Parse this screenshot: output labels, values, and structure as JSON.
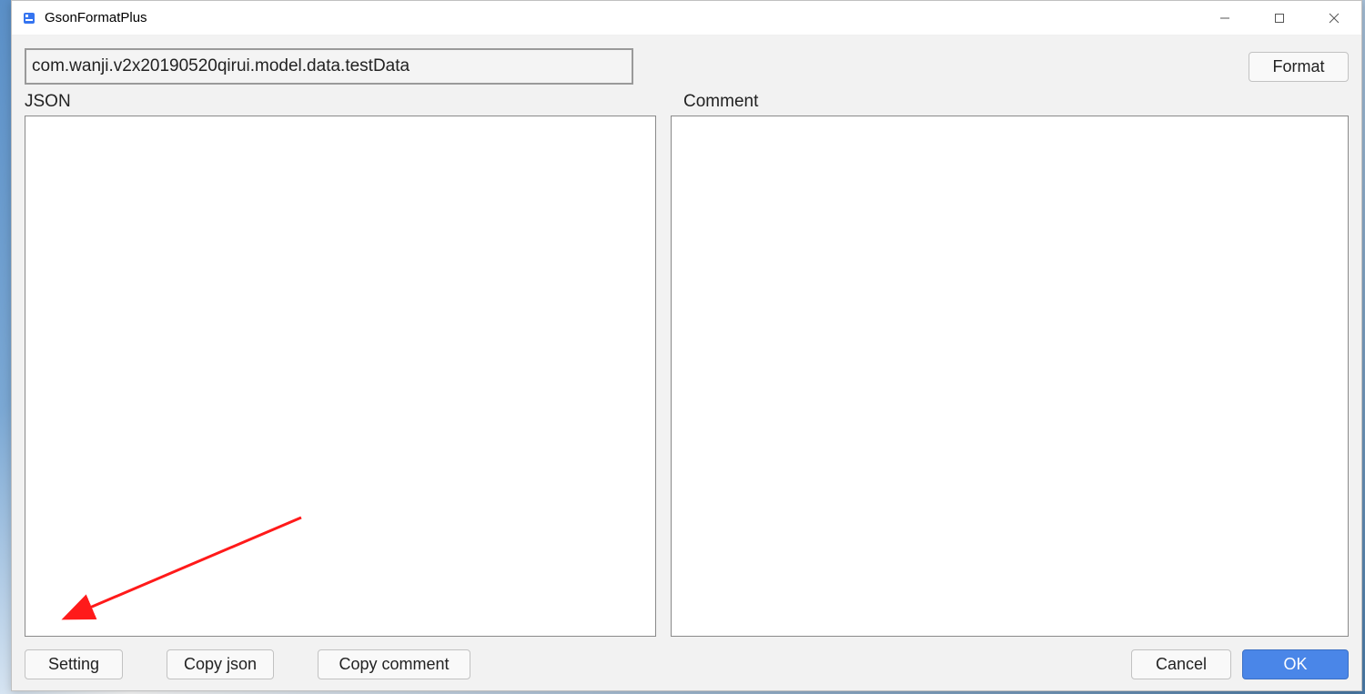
{
  "window": {
    "title": "GsonFormatPlus"
  },
  "topRow": {
    "classPathValue": "com.wanji.v2x20190520qirui.model.data.testData",
    "formatLabel": "Format"
  },
  "labels": {
    "json": "JSON",
    "comment": "Comment"
  },
  "editors": {
    "jsonValue": "",
    "commentValue": ""
  },
  "bottom": {
    "settingLabel": "Setting",
    "copyJsonLabel": "Copy  json",
    "copyCommentLabel": "Copy comment",
    "cancelLabel": "Cancel",
    "okLabel": "OK"
  }
}
